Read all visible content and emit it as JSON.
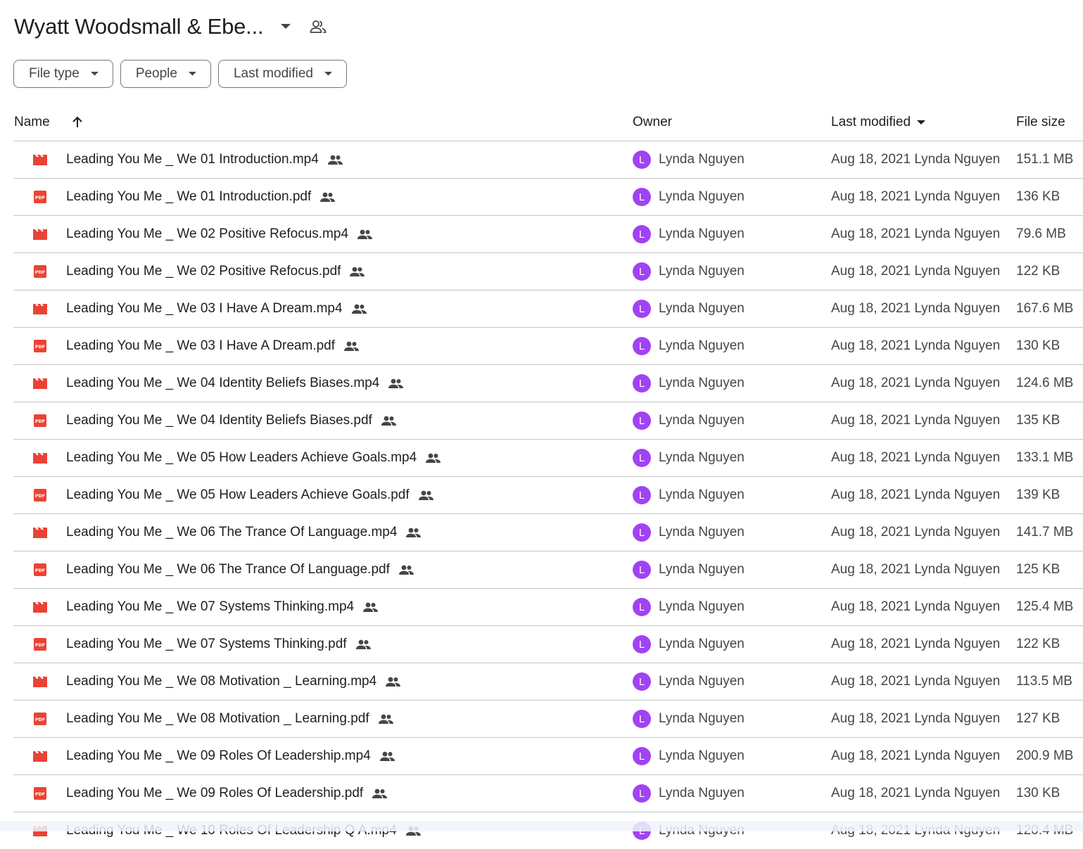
{
  "header": {
    "title": "Wyatt Woodsmall & Ebe...",
    "caret_icon": "arrow-drop-down-icon",
    "shared_icon": "people-outline-icon"
  },
  "filters": [
    {
      "label": "File type"
    },
    {
      "label": "People"
    },
    {
      "label": "Last modified"
    }
  ],
  "columns": {
    "name": "Name",
    "owner": "Owner",
    "last_modified": "Last modified",
    "file_size": "File size"
  },
  "colors": {
    "video_icon": "#ea4335",
    "pdf_icon": "#ea4335",
    "avatar": "#a142f4"
  },
  "files": [
    {
      "type": "video",
      "name": "Leading You Me _ We 01 Introduction.mp4",
      "owner_initial": "L",
      "owner": "Lynda Nguyen",
      "modified": "Aug 18, 2021 Lynda Nguyen",
      "size": "151.1 MB"
    },
    {
      "type": "pdf",
      "name": "Leading You Me _ We 01 Introduction.pdf",
      "owner_initial": "L",
      "owner": "Lynda Nguyen",
      "modified": "Aug 18, 2021 Lynda Nguyen",
      "size": "136 KB"
    },
    {
      "type": "video",
      "name": "Leading You Me _ We 02 Positive Refocus.mp4",
      "owner_initial": "L",
      "owner": "Lynda Nguyen",
      "modified": "Aug 18, 2021 Lynda Nguyen",
      "size": "79.6 MB"
    },
    {
      "type": "pdf",
      "name": "Leading You Me _ We 02 Positive Refocus.pdf",
      "owner_initial": "L",
      "owner": "Lynda Nguyen",
      "modified": "Aug 18, 2021 Lynda Nguyen",
      "size": "122 KB"
    },
    {
      "type": "video",
      "name": "Leading You Me _ We 03 I Have A Dream.mp4",
      "owner_initial": "L",
      "owner": "Lynda Nguyen",
      "modified": "Aug 18, 2021 Lynda Nguyen",
      "size": "167.6 MB"
    },
    {
      "type": "pdf",
      "name": "Leading You Me _ We 03 I Have A Dream.pdf",
      "owner_initial": "L",
      "owner": "Lynda Nguyen",
      "modified": "Aug 18, 2021 Lynda Nguyen",
      "size": "130 KB"
    },
    {
      "type": "video",
      "name": "Leading You Me _ We 04 Identity Beliefs Biases.mp4",
      "owner_initial": "L",
      "owner": "Lynda Nguyen",
      "modified": "Aug 18, 2021 Lynda Nguyen",
      "size": "124.6 MB"
    },
    {
      "type": "pdf",
      "name": "Leading You Me _ We 04 Identity Beliefs Biases.pdf",
      "owner_initial": "L",
      "owner": "Lynda Nguyen",
      "modified": "Aug 18, 2021 Lynda Nguyen",
      "size": "135 KB"
    },
    {
      "type": "video",
      "name": "Leading You Me _ We 05 How Leaders Achieve Goals.mp4",
      "owner_initial": "L",
      "owner": "Lynda Nguyen",
      "modified": "Aug 18, 2021 Lynda Nguyen",
      "size": "133.1 MB"
    },
    {
      "type": "pdf",
      "name": "Leading You Me _ We 05 How Leaders Achieve Goals.pdf",
      "owner_initial": "L",
      "owner": "Lynda Nguyen",
      "modified": "Aug 18, 2021 Lynda Nguyen",
      "size": "139 KB"
    },
    {
      "type": "video",
      "name": "Leading You Me _ We 06 The Trance Of Language.mp4",
      "owner_initial": "L",
      "owner": "Lynda Nguyen",
      "modified": "Aug 18, 2021 Lynda Nguyen",
      "size": "141.7 MB"
    },
    {
      "type": "pdf",
      "name": "Leading You Me _ We 06 The Trance Of Language.pdf",
      "owner_initial": "L",
      "owner": "Lynda Nguyen",
      "modified": "Aug 18, 2021 Lynda Nguyen",
      "size": "125 KB"
    },
    {
      "type": "video",
      "name": "Leading You Me _ We 07 Systems Thinking.mp4",
      "owner_initial": "L",
      "owner": "Lynda Nguyen",
      "modified": "Aug 18, 2021 Lynda Nguyen",
      "size": "125.4 MB"
    },
    {
      "type": "pdf",
      "name": "Leading You Me _ We 07 Systems Thinking.pdf",
      "owner_initial": "L",
      "owner": "Lynda Nguyen",
      "modified": "Aug 18, 2021 Lynda Nguyen",
      "size": "122 KB"
    },
    {
      "type": "video",
      "name": "Leading You Me _ We 08 Motivation _ Learning.mp4",
      "owner_initial": "L",
      "owner": "Lynda Nguyen",
      "modified": "Aug 18, 2021 Lynda Nguyen",
      "size": "113.5 MB"
    },
    {
      "type": "pdf",
      "name": "Leading You Me _ We 08 Motivation _ Learning.pdf",
      "owner_initial": "L",
      "owner": "Lynda Nguyen",
      "modified": "Aug 18, 2021 Lynda Nguyen",
      "size": "127 KB"
    },
    {
      "type": "video",
      "name": "Leading You Me _ We 09 Roles Of Leadership.mp4",
      "owner_initial": "L",
      "owner": "Lynda Nguyen",
      "modified": "Aug 18, 2021 Lynda Nguyen",
      "size": "200.9 MB"
    },
    {
      "type": "pdf",
      "name": "Leading You Me _ We 09 Roles Of Leadership.pdf",
      "owner_initial": "L",
      "owner": "Lynda Nguyen",
      "modified": "Aug 18, 2021 Lynda Nguyen",
      "size": "130 KB"
    },
    {
      "type": "video",
      "name": "Leading You Me _ We 10 Roles Of Leadership Q A.mp4",
      "owner_initial": "L",
      "owner": "Lynda Nguyen",
      "modified": "Aug 18, 2021 Lynda Nguyen",
      "size": "120.4 MB"
    }
  ]
}
